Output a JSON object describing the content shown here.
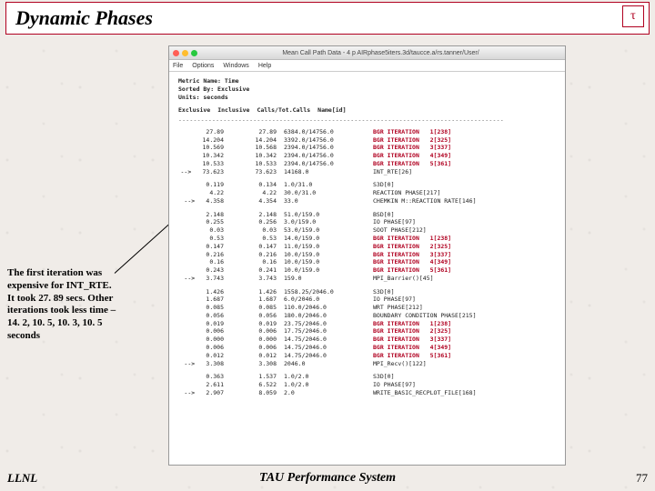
{
  "slide": {
    "title": "Dynamic Phases",
    "logo_glyph": "τ",
    "annotation": "The first iteration was expensive for INT_RTE. It took 27. 89 secs. Other iterations took less time – 14. 2, 10. 5, 10. 3, 10. 5 seconds",
    "footer_left": "LLNL",
    "footer_center": "TAU Performance System",
    "footer_right": "77"
  },
  "window": {
    "title": "Mean Call Path Data - 4 p AIRphase5iters.3d/taucce.a/rs.tanner/User/",
    "menus": [
      "File",
      "Options",
      "Windows",
      "Help"
    ],
    "meta_lines": [
      "Metric Name: Time",
      "Sorted By: Exclusive",
      "Units: seconds"
    ],
    "columns": [
      "Exclusive",
      "Inclusive",
      "Calls/Tot.Calls",
      "Name[id]"
    ],
    "groups": [
      {
        "rows": [
          {
            "c1": "27.89",
            "c2": "27.89",
            "c3": "6384.0/14756.0",
            "c4": "BGR ITERATION   1[238]",
            "red": true
          },
          {
            "c1": "14.204",
            "c2": "14.204",
            "c3": "3392.0/14756.0",
            "c4": "BGR ITERATION   2[325]",
            "red": true
          },
          {
            "c1": "10.569",
            "c2": "10.568",
            "c3": "2394.0/14756.0",
            "c4": "BGR ITERATION   3[337]",
            "red": true
          },
          {
            "c1": "10.342",
            "c2": "10.342",
            "c3": "2394.0/14756.0",
            "c4": "BGR ITERATION   4[349]",
            "red": true
          },
          {
            "c1": "10.533",
            "c2": "10.533",
            "c3": "2394.0/14756.0",
            "c4": "BGR ITERATION   5[361]",
            "red": true
          },
          {
            "c1": "73.623",
            "c2": "73.623",
            "c3": "14168.0",
            "c4": "INT_RTE[26]",
            "arrow": true
          }
        ]
      },
      {
        "rows": [
          {
            "c1": "0.119",
            "c2": "0.134",
            "c3": "1.0/31.0",
            "c4": "S3D[0]"
          },
          {
            "c1": "4.22",
            "c2": "4.22",
            "c3": "30.0/31.0",
            "c4": "REACTION PHASE[217]"
          },
          {
            "c1": "4.358",
            "c2": "4.354",
            "c3": "33.0",
            "c4": "CHEMKIN M::REACTION RATE[146]",
            "arrow": true
          }
        ]
      },
      {
        "rows": [
          {
            "c1": "2.148",
            "c2": "2.148",
            "c3": "51.0/159.0",
            "c4": "BSD[0]"
          },
          {
            "c1": "0.255",
            "c2": "0.256",
            "c3": "3.0/159.0",
            "c4": "IO PHASE[97]"
          },
          {
            "c1": "0.03",
            "c2": "0.03",
            "c3": "53.0/159.0",
            "c4": "SOOT PHASE[212]"
          },
          {
            "c1": "0.53",
            "c2": "0.53",
            "c3": "14.0/159.0",
            "c4": "BGR ITERATION   1[238]",
            "red": true
          },
          {
            "c1": "0.147",
            "c2": "0.147",
            "c3": "11.0/159.0",
            "c4": "BGR ITERATION   2[325]",
            "red": true
          },
          {
            "c1": "0.216",
            "c2": "0.216",
            "c3": "10.0/159.0",
            "c4": "BGR ITERATION   3[337]",
            "red": true
          },
          {
            "c1": "0.16",
            "c2": "0.16",
            "c3": "10.0/159.0",
            "c4": "BGR ITERATION   4[349]",
            "red": true
          },
          {
            "c1": "0.243",
            "c2": "0.241",
            "c3": "10.0/159.0",
            "c4": "BGR ITERATION   5[361]",
            "red": true
          },
          {
            "c1": "3.743",
            "c2": "3.743",
            "c3": "159.0",
            "c4": "MPI_Barrier()[45]",
            "arrow": true
          }
        ]
      },
      {
        "rows": [
          {
            "c1": "1.426",
            "c2": "1.426",
            "c3": "1558.25/2046.0",
            "c4": "S3D[0]"
          },
          {
            "c1": "1.687",
            "c2": "1.687",
            "c3": "6.0/2046.0",
            "c4": "IO PHASE[97]"
          },
          {
            "c1": "0.085",
            "c2": "0.085",
            "c3": "110.0/2046.0",
            "c4": "WRT PHASE[212]"
          },
          {
            "c1": "0.056",
            "c2": "0.056",
            "c3": "180.0/2046.0",
            "c4": "BOUNDARY CONDITION PHASE[215]"
          },
          {
            "c1": "0.019",
            "c2": "0.019",
            "c3": "23.75/2046.0",
            "c4": "BGR ITERATION   1[238]",
            "red": true
          },
          {
            "c1": "0.006",
            "c2": "0.006",
            "c3": "17.75/2046.0",
            "c4": "BGR ITERATION   2[325]",
            "red": true
          },
          {
            "c1": "0.000",
            "c2": "0.000",
            "c3": "14.75/2046.0",
            "c4": "BGR ITERATION   3[337]",
            "red": true
          },
          {
            "c1": "0.006",
            "c2": "0.006",
            "c3": "14.75/2046.0",
            "c4": "BGR ITERATION   4[349]",
            "red": true
          },
          {
            "c1": "0.012",
            "c2": "0.012",
            "c3": "14.75/2046.0",
            "c4": "BGR ITERATION   5[361]",
            "red": true
          },
          {
            "c1": "3.308",
            "c2": "3.308",
            "c3": "2046.0",
            "c4": "MPI_Recv()[122]",
            "arrow": true
          }
        ]
      },
      {
        "rows": [
          {
            "c1": "0.363",
            "c2": "1.537",
            "c3": "1.0/2.0",
            "c4": "S3D[0]"
          },
          {
            "c1": "2.611",
            "c2": "6.522",
            "c3": "1.0/2.0",
            "c4": "IO PHASE[97]"
          },
          {
            "c1": "2.907",
            "c2": "8.059",
            "c3": "2.0",
            "c4": "WRITE_BASIC_RECPLOT_FILE[168]",
            "arrow": true
          }
        ]
      }
    ]
  }
}
